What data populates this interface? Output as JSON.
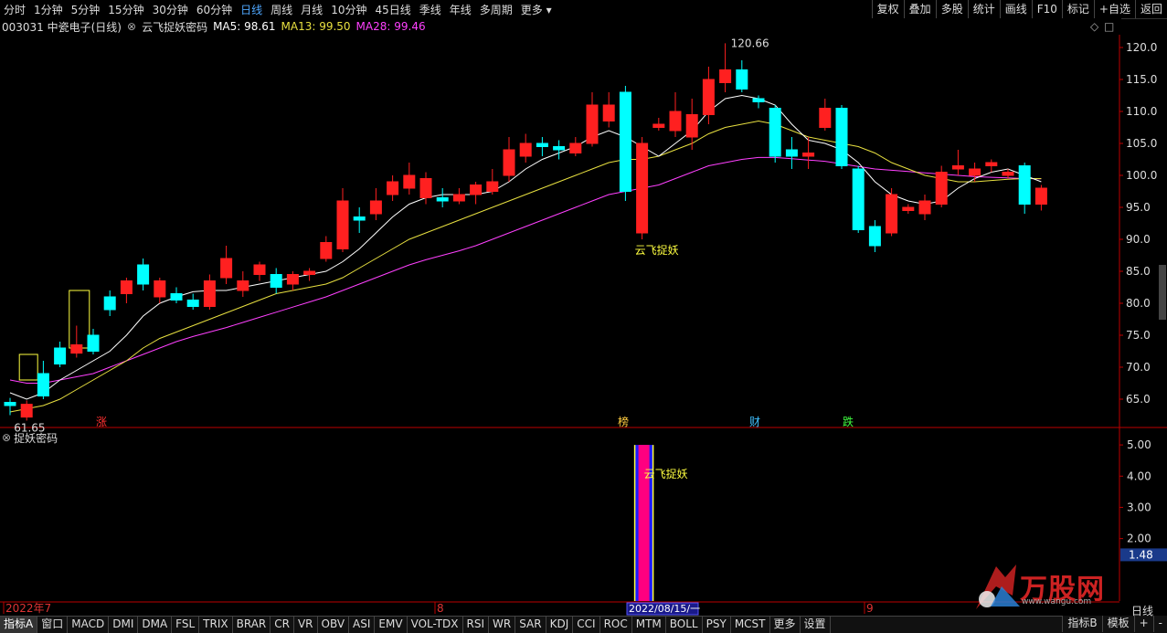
{
  "toolbar": {
    "periods": [
      "分时",
      "1分钟",
      "5分钟",
      "15分钟",
      "30分钟",
      "60分钟",
      "日线",
      "周线",
      "月线",
      "10分钟",
      "45日线",
      "季线",
      "年线",
      "多周期",
      "更多 ▾"
    ],
    "active_period": "日线",
    "right_buttons": [
      "复权",
      "叠加",
      "多股",
      "统计",
      "画线",
      "F10",
      "标记",
      "+自选",
      "返回"
    ]
  },
  "stock": {
    "code_name": "003031 中瓷电子(日线)",
    "indicator_name": "云飞捉妖密码",
    "ma5": "MA5: 98.61",
    "ma13": "MA13: 99.50",
    "ma28": "MA28: 99.46"
  },
  "colors": {
    "up": "#ff2020",
    "down": "#00ffff",
    "ma5": "#ffffff",
    "ma13": "#e8e040",
    "ma28": "#ff40ff",
    "signal": "#ff0080",
    "label": "#ffff40"
  },
  "chart_data": {
    "type": "candlestick",
    "ylim": [
      62,
      122
    ],
    "y_ticks": [
      "120.0",
      "115.0",
      "110.0",
      "105.0",
      "100.0",
      "95.0",
      "90.0",
      "85.0",
      "80.0",
      "75.0",
      "70.0",
      "65.0"
    ],
    "high_label": "120.66",
    "low_label": "61.65",
    "candles": [
      [
        64.5,
        64.0,
        65.2,
        62.5
      ],
      [
        62.2,
        64.2,
        64.8,
        61.65
      ],
      [
        69.0,
        65.5,
        71.0,
        65.0
      ],
      [
        73.0,
        70.5,
        74.0,
        70.0
      ],
      [
        72.2,
        73.5,
        76.5,
        71.5
      ],
      [
        75.0,
        72.5,
        76.0,
        72.0
      ],
      [
        81.0,
        79.0,
        82.0,
        78.0
      ],
      [
        81.5,
        83.5,
        84.0,
        80.0
      ],
      [
        86.0,
        83.0,
        87.0,
        82.0
      ],
      [
        81.0,
        83.5,
        84.0,
        80.0
      ],
      [
        81.5,
        80.5,
        82.5,
        80.0
      ],
      [
        80.5,
        79.5,
        81.5,
        79.0
      ],
      [
        79.5,
        83.5,
        84.5,
        79.0
      ],
      [
        84.0,
        87.0,
        89.0,
        83.0
      ],
      [
        82.0,
        83.5,
        85.0,
        81.0
      ],
      [
        84.5,
        86.0,
        86.5,
        83.5
      ],
      [
        84.5,
        82.5,
        85.5,
        81.5
      ],
      [
        83.0,
        84.5,
        85.0,
        82.0
      ],
      [
        84.5,
        85.0,
        85.5,
        83.5
      ],
      [
        87.0,
        89.5,
        90.5,
        86.5
      ],
      [
        88.5,
        96.0,
        98.0,
        88.0
      ],
      [
        93.5,
        93.0,
        95.0,
        91.0
      ],
      [
        94.0,
        96.0,
        98.0,
        93.0
      ],
      [
        97.0,
        99.0,
        100.0,
        96.0
      ],
      [
        98.0,
        100.0,
        102.0,
        97.0
      ],
      [
        96.5,
        99.5,
        100.5,
        95.5
      ],
      [
        96.5,
        96.0,
        98.0,
        95.0
      ],
      [
        96.0,
        97.0,
        98.0,
        95.5
      ],
      [
        97.0,
        98.5,
        99.0,
        95.5
      ],
      [
        97.5,
        99.0,
        101.0,
        97.0
      ],
      [
        100.0,
        104.0,
        106.0,
        99.0
      ],
      [
        103.0,
        105.0,
        106.5,
        102.0
      ],
      [
        105.0,
        104.5,
        106.0,
        103.0
      ],
      [
        104.5,
        104.0,
        105.5,
        102.5
      ],
      [
        103.5,
        105.0,
        106.0,
        103.0
      ],
      [
        105.0,
        111.0,
        113.0,
        104.5
      ],
      [
        108.5,
        111.0,
        113.0,
        107.5
      ],
      [
        113.0,
        97.5,
        114.0,
        96.0
      ],
      [
        91.0,
        105.0,
        106.0,
        90.0
      ],
      [
        107.5,
        108.0,
        109.0,
        107.0
      ],
      [
        107.0,
        110.0,
        113.0,
        106.0
      ],
      [
        106.0,
        109.5,
        112.0,
        104.0
      ],
      [
        109.5,
        115.0,
        117.0,
        108.0
      ],
      [
        114.5,
        116.5,
        120.66,
        113.0
      ],
      [
        116.5,
        113.5,
        118.0,
        113.0
      ],
      [
        112.0,
        111.5,
        112.5,
        110.5
      ],
      [
        110.5,
        103.0,
        111.0,
        102.0
      ],
      [
        104.0,
        103.0,
        106.0,
        101.0
      ],
      [
        103.0,
        103.5,
        106.0,
        101.0
      ],
      [
        107.5,
        110.5,
        112.0,
        107.0
      ],
      [
        110.5,
        101.5,
        111.0,
        101.0
      ],
      [
        101.0,
        91.5,
        101.5,
        91.0
      ],
      [
        92.0,
        89.0,
        93.0,
        88.0
      ],
      [
        91.0,
        97.0,
        98.0,
        90.5
      ],
      [
        94.5,
        95.0,
        95.5,
        94.0
      ],
      [
        94.0,
        96.0,
        97.0,
        93.0
      ],
      [
        95.5,
        100.5,
        101.5,
        95.0
      ],
      [
        101.0,
        101.5,
        104.0,
        100.0
      ],
      [
        100.0,
        101.0,
        102.0,
        99.0
      ],
      [
        101.5,
        102.0,
        102.5,
        100.5
      ],
      [
        100.0,
        100.5,
        101.0,
        99.5
      ],
      [
        101.5,
        95.5,
        102.0,
        94.0
      ],
      [
        95.5,
        98.0,
        98.5,
        94.5
      ]
    ],
    "ma5": [
      66.0,
      65.0,
      66.0,
      68.0,
      69.5,
      71.0,
      72.5,
      75.0,
      78.0,
      80.0,
      81.0,
      81.8,
      82.0,
      82.0,
      82.5,
      83.0,
      83.5,
      84.0,
      84.5,
      85.0,
      86.5,
      88.5,
      91.0,
      93.5,
      95.5,
      96.5,
      97.0,
      97.0,
      97.0,
      97.5,
      99.0,
      101.0,
      102.5,
      103.5,
      104.5,
      106.0,
      107.0,
      106.0,
      104.5,
      103.0,
      105.0,
      107.0,
      110.0,
      112.0,
      112.5,
      112.0,
      111.0,
      108.0,
      105.5,
      105.0,
      104.0,
      102.0,
      99.0,
      97.0,
      96.0,
      95.5,
      96.0,
      98.0,
      99.5,
      100.5,
      101.0,
      100.0,
      99.0
    ],
    "ma13": [
      63.0,
      63.5,
      64.0,
      65.0,
      66.5,
      68.0,
      69.5,
      71.0,
      73.0,
      74.5,
      75.5,
      76.5,
      77.5,
      78.5,
      79.5,
      80.5,
      81.5,
      82.0,
      82.5,
      83.0,
      84.0,
      85.5,
      87.0,
      88.5,
      90.0,
      91.0,
      92.0,
      93.0,
      94.0,
      95.0,
      96.0,
      97.0,
      98.0,
      99.0,
      100.0,
      101.0,
      102.0,
      102.5,
      102.5,
      103.0,
      104.0,
      105.0,
      106.5,
      107.5,
      108.0,
      108.5,
      108.0,
      107.0,
      106.0,
      105.5,
      105.0,
      104.5,
      103.5,
      102.0,
      101.0,
      100.0,
      99.5,
      99.0,
      99.0,
      99.2,
      99.4,
      99.5,
      99.5
    ],
    "ma28": [
      68.0,
      67.5,
      67.5,
      68.0,
      68.5,
      69.0,
      70.0,
      71.0,
      72.0,
      73.0,
      74.0,
      74.8,
      75.5,
      76.2,
      77.0,
      77.8,
      78.6,
      79.4,
      80.2,
      81.0,
      82.0,
      83.0,
      84.0,
      85.0,
      86.0,
      86.8,
      87.5,
      88.2,
      89.0,
      90.0,
      91.0,
      92.0,
      93.0,
      94.0,
      95.0,
      96.0,
      97.0,
      97.5,
      98.0,
      98.5,
      99.5,
      100.5,
      101.5,
      102.0,
      102.5,
      102.8,
      102.8,
      102.6,
      102.4,
      102.2,
      101.8,
      101.4,
      101.0,
      100.8,
      100.6,
      100.4,
      100.2,
      100.0,
      99.8,
      99.7,
      99.6,
      99.5,
      99.46
    ],
    "yellow_boxes": [
      [
        1,
        68.0,
        72.0
      ],
      [
        4,
        73.0,
        82.0
      ]
    ],
    "annotation": {
      "text": "云飞捉妖",
      "index": 38
    },
    "event_labels": [
      {
        "text": "涨",
        "index": 4,
        "color": "#ff3030"
      },
      {
        "text": "榜",
        "index": 26,
        "color": "#ffcc40"
      },
      {
        "text": "财",
        "index": 32,
        "color": "#40c0ff"
      },
      {
        "text": "跌",
        "index": 36,
        "color": "#40ff40"
      }
    ],
    "indicator": {
      "ylim": [
        0,
        5.5
      ],
      "y_ticks": [
        "5.00",
        "4.00",
        "3.00",
        "2.00"
      ],
      "current_value": "1.48",
      "signal_index": 38,
      "signal_value": 5.0,
      "label": "云飞捉妖"
    },
    "x_labels": [
      "2022年7",
      "8",
      "9"
    ],
    "cursor_date": "2022/08/15/一"
  },
  "indicator_panel": {
    "title": "捉妖密码"
  },
  "bottom_tabs": [
    "指标A",
    "窗口",
    "MACD",
    "DMI",
    "DMA",
    "FSL",
    "TRIX",
    "BRAR",
    "CR",
    "VR",
    "OBV",
    "ASI",
    "EMV",
    "VOL-TDX",
    "RSI",
    "WR",
    "SAR",
    "KDJ",
    "CCI",
    "ROC",
    "MTM",
    "BOLL",
    "PSY",
    "MCST",
    "更多",
    "设置"
  ],
  "bottom_right": [
    "指标B",
    "模板",
    "+",
    "-"
  ],
  "bottom_right_label": "日线",
  "watermark": {
    "text": "万股网",
    "sub": "www.wangu.com"
  }
}
